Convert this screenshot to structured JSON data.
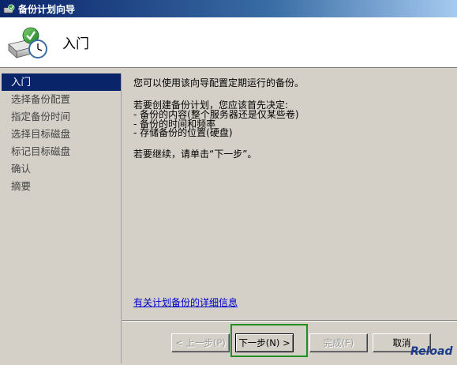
{
  "window": {
    "title": "备份计划向导"
  },
  "header": {
    "title": "入门"
  },
  "sidebar": {
    "items": [
      {
        "label": "入门",
        "active": true
      },
      {
        "label": "选择备份配置",
        "active": false
      },
      {
        "label": "指定备份时间",
        "active": false
      },
      {
        "label": "选择目标磁盘",
        "active": false
      },
      {
        "label": "标记目标磁盘",
        "active": false
      },
      {
        "label": "确认",
        "active": false
      },
      {
        "label": "摘要",
        "active": false
      }
    ]
  },
  "content": {
    "intro": "您可以使用该向导配置定期运行的备份。",
    "decide_heading": "若要创建备份计划，您应该首先决定:",
    "bullets": [
      "- 备份的内容(整个服务器还是仅某些卷)",
      "- 备份的时间和频率",
      "- 存储备份的位置(硬盘)"
    ],
    "continue_text": "若要继续，请单击“下一步”。",
    "details_link": "有关计划备份的详细信息"
  },
  "buttons": {
    "prev": "< 上一步(P)",
    "next": "下一步(N) >",
    "finish": "完成(F)",
    "cancel": "取消"
  },
  "overlay": {
    "reload": "Reload"
  },
  "colors": {
    "titlebar": "#0a246a",
    "active_nav": "#0a246a",
    "link": "#0000cc",
    "highlight_box": "#1f8f1f"
  }
}
